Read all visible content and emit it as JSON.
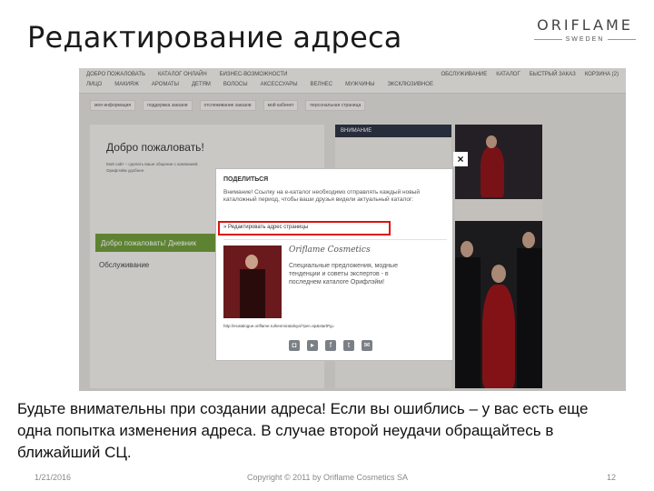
{
  "slide": {
    "title": "Редактирование адреса",
    "brand_name": "ORIFLAME",
    "brand_sub": "SWEDEN"
  },
  "website": {
    "top_links_left": [
      "ДОБРО ПОЖАЛОВАТЬ",
      "КАТАЛОГ ОНЛАЙН",
      "БИЗНЕС-ВОЗМОЖНОСТИ"
    ],
    "top_links_right": [
      "ОБСЛУЖИВАНИЕ",
      "КАТАЛОГ",
      "БЫСТРЫЙ ЗАКАЗ",
      "КОРЗИНА (2)"
    ],
    "categories": [
      "ЛИЦО",
      "МАКИЯЖ",
      "АРОМАТЫ",
      "ДЕТЯМ",
      "ВОЛОСЫ",
      "АКСЕССУАРЫ",
      "ВЕЛНЕС",
      "МУЖЧИНЫ",
      "ЭКСКЛЮЗИВНОЕ"
    ],
    "sub_tabs": [
      "моя информация",
      "поддержка заказов",
      "отслеживание заказов",
      "мой кабинет",
      "персональная страница"
    ],
    "welcome": "Добро пожаловать!",
    "welcome_body": "Мой сайт – сделать ваше общение с компанией Орифлэйм удобнее.",
    "green_bar": "Добро пожаловать! Дневник",
    "service": "Обслуживание",
    "mid_header": "ВНИМАНИЕ"
  },
  "modal": {
    "title": "ПОДЕЛИТЬСЯ",
    "notice": "Внимание! Ссылку на е-каталог необходимо отправлять каждый новый каталожный период, чтобы ваши друзья видели актуальный каталог:",
    "edit_link": "» Редактировать адрес страницы",
    "brand": "Oriflame Cosmetics",
    "description": "Специальные предложения, модные тенденции и советы экспертов - в последнем каталоге Орифлэйм!",
    "url": "http://ecatalogue.oriflame.ru/kenmiratalsya/?per=sp&startPg=",
    "close_label": "×",
    "share_icons": [
      "◘",
      "▸",
      "f",
      "t",
      "✉"
    ]
  },
  "caption": "Будьте внимательны при создании адреса! Если вы ошиблись – у вас есть еще одна попытка изменения адреса. В случае второй неудачи обращайтесь в ближайший СЦ.",
  "footer": {
    "date": "1/21/2016",
    "copyright": "Copyright © 2011 by Oriflame Cosmetics SA",
    "page": "12"
  }
}
